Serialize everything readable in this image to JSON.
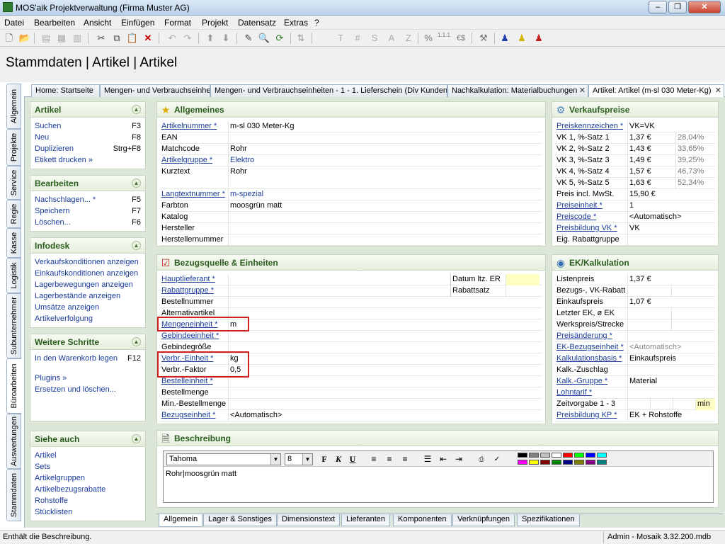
{
  "window": {
    "title": "MOS'aik Projektverwaltung (Firma Muster AG)",
    "min": "–",
    "max": "❐",
    "close": "✕"
  },
  "menu": [
    "Datei",
    "Bearbeiten",
    "Ansicht",
    "Einfügen",
    "Format",
    "Projekt",
    "Datensatz",
    "Extras",
    "?"
  ],
  "toolbar_icons": [
    "new-icon",
    "open-icon",
    "print-icon",
    "print-preview-icon",
    "print-setup-icon",
    "cut-icon",
    "copy-icon",
    "paste-icon",
    "delete-icon",
    "undo-icon",
    "redo-icon",
    "up-icon",
    "down-icon",
    "edit-icon",
    "search-icon",
    "refresh-icon",
    "sort-icon",
    "T",
    "#",
    "S",
    "A",
    "Z",
    "%",
    "1.1.1",
    "€$",
    "tools-icon",
    "user-blue-icon",
    "user-yellow-icon",
    "user-red-icon"
  ],
  "heading": "Stammdaten | Artikel | Artikel",
  "vtabs": [
    "Allgemein",
    "Projekte",
    "Service",
    "Regie",
    "Kasse",
    "Logistik",
    "Subunternehmer",
    "Büroarbeiten",
    "Auswertungen",
    "Stammdaten"
  ],
  "doctabs": [
    {
      "label": "Home: Startseite"
    },
    {
      "label": "Mengen- und Verbrauchseinhe"
    },
    {
      "label": "Mengen- und Verbrauchseinheiten - 1 - 1. Lieferschein (Div Kunden)"
    },
    {
      "label": "Nachkalkulation: Materialbuchungen"
    },
    {
      "label": "Artikel: Artikel (m-sl 030 Meter-Kg)"
    }
  ],
  "left_panels": {
    "artikel": {
      "title": "Artikel",
      "items": [
        {
          "label": "Suchen",
          "key": "F3"
        },
        {
          "label": "Neu",
          "key": "F8"
        },
        {
          "label": "Duplizieren",
          "key": "Strg+F8"
        },
        {
          "label": "Etikett drucken »",
          "key": ""
        }
      ]
    },
    "bearbeiten": {
      "title": "Bearbeiten",
      "items": [
        {
          "label": "Nachschlagen... *",
          "key": "F5"
        },
        {
          "label": "Speichern",
          "key": "F7"
        },
        {
          "label": "Löschen...",
          "key": "F6"
        }
      ]
    },
    "infodesk": {
      "title": "Infodesk",
      "items": [
        {
          "label": "Verkaufskonditionen anzeigen"
        },
        {
          "label": "Einkaufskonditionen anzeigen"
        },
        {
          "label": "Lagerbewegungen anzeigen"
        },
        {
          "label": "Lagerbestände anzeigen"
        },
        {
          "label": "Umsätze anzeigen"
        },
        {
          "label": "Artikelverfolgung"
        }
      ]
    },
    "weitere": {
      "title": "Weitere Schritte",
      "items": [
        {
          "label": "In den Warenkorb legen",
          "key": "F12"
        },
        {
          "label": "Plugins »",
          "key": ""
        },
        {
          "label": "Ersetzen und löschen...",
          "key": ""
        }
      ]
    },
    "siehe": {
      "title": "Siehe auch",
      "items": [
        {
          "label": "Artikel"
        },
        {
          "label": "Sets"
        },
        {
          "label": "Artikelgruppen"
        },
        {
          "label": "Artikelbezugsrabatte"
        },
        {
          "label": "Rohstoffe"
        },
        {
          "label": "Stücklisten"
        }
      ]
    }
  },
  "allgemeines": {
    "title": "Allgemeines",
    "rows": [
      {
        "label": "Artikelnummer *",
        "value": "m-sl 030 Meter-Kg",
        "link": true
      },
      {
        "label": "EAN",
        "value": "",
        "link": false
      },
      {
        "label": "Matchcode",
        "value": "Rohr",
        "link": false
      },
      {
        "label": "Artikelgruppe *",
        "value": "Elektro",
        "link": true,
        "blue": true
      },
      {
        "label": "Kurztext",
        "value": "Rohr",
        "link": false,
        "tall": true
      },
      {
        "label": "Langtextnummer *",
        "value": "m-spezial",
        "link": true,
        "blue": true
      },
      {
        "label": "Farbton",
        "value": "moosgrün matt",
        "link": false
      },
      {
        "label": "Katalog",
        "value": "",
        "link": false
      },
      {
        "label": "Hersteller",
        "value": "",
        "link": false
      },
      {
        "label": "Herstellernummer",
        "value": "",
        "link": false
      }
    ]
  },
  "verkaufspreise": {
    "title": "Verkaufspreise",
    "rows": [
      {
        "label": "Preiskennzeichen *",
        "value": "VK=VK",
        "pct": "",
        "link": true
      },
      {
        "label": "VK 1, %-Satz 1",
        "value": "1,37 €",
        "pct": "28,04%"
      },
      {
        "label": "VK 2, %-Satz 2",
        "value": "1,43 €",
        "pct": "33,65%"
      },
      {
        "label": "VK 3, %-Satz 3",
        "value": "1,49 €",
        "pct": "39,25%"
      },
      {
        "label": "VK 4, %-Satz 4",
        "value": "1,57 €",
        "pct": "46,73%"
      },
      {
        "label": "VK 5, %-Satz 5",
        "value": "1,63 €",
        "pct": "52,34%"
      },
      {
        "label": "Preis incl. MwSt.",
        "value": "15,90 €",
        "pct": ""
      },
      {
        "label": "Preiseinheit *",
        "value": "1",
        "pct": "",
        "link": true
      },
      {
        "label": "Preiscode *",
        "value": "<Automatisch>",
        "pct": "",
        "link": true
      },
      {
        "label": "Preisbildung VK *",
        "value": "VK",
        "pct": "",
        "link": true
      },
      {
        "label": "Eig. Rabattgruppe",
        "value": "",
        "pct": ""
      }
    ]
  },
  "bezugsquelle": {
    "title": "Bezugsquelle & Einheiten",
    "rows": [
      {
        "label": "Hauptlieferant *",
        "value": "",
        "link": true
      },
      {
        "label": "Rabattgruppe *",
        "value": "",
        "link": true
      },
      {
        "label": "Bestellnummer",
        "value": ""
      },
      {
        "label": "Alternativartikel",
        "value": ""
      },
      {
        "label": "Mengeneinheit *",
        "value": "m",
        "link": true
      },
      {
        "label": "Gebindeeinheit *",
        "value": "",
        "link": true
      },
      {
        "label": "Gebindegröße",
        "value": ""
      },
      {
        "label": "Verbr.-Einheit *",
        "value": "kg",
        "link": true
      },
      {
        "label": "Verbr.-Faktor",
        "value": "0,5"
      },
      {
        "label": "Bestelleinheit *",
        "value": "",
        "link": true
      },
      {
        "label": "Bestellmenge",
        "value": ""
      },
      {
        "label": "Min.-Bestellmenge",
        "value": ""
      },
      {
        "label": "Bezugseinheit *",
        "value": "<Automatisch>",
        "link": true
      }
    ],
    "side": [
      {
        "label": "Datum ltz. ER",
        "value": ""
      },
      {
        "label": "Rabattsatz",
        "value": ""
      }
    ]
  },
  "ek": {
    "title": "EK/Kalkulation",
    "rows": [
      {
        "label": "Listenpreis",
        "value": "1,37 €"
      },
      {
        "label": "Bezugs-, VK-Rabatt",
        "value": ""
      },
      {
        "label": "Einkaufspreis",
        "value": "1,07 €"
      },
      {
        "label": "Letzter EK, ø EK",
        "value": ""
      },
      {
        "label": "Werkspreis/Strecke",
        "value": ""
      },
      {
        "label": "Preisänderung *",
        "value": "",
        "link": true
      },
      {
        "label": "EK-Bezugseinheit *",
        "value": "<Automatisch>",
        "link": true,
        "grey": true
      },
      {
        "label": "Kalkulationsbasis *",
        "value": "Einkaufspreis",
        "link": true
      },
      {
        "label": "Kalk.-Zuschlag",
        "value": ""
      },
      {
        "label": "Kalk.-Gruppe *",
        "value": "Material",
        "link": true
      },
      {
        "label": "Lohntarif *",
        "value": "",
        "link": true
      },
      {
        "label": "Zeitvorgabe 1 - 3",
        "value": "",
        "unit": "min"
      },
      {
        "label": "Preisbildung KP *",
        "value": "EK + Rohstoffe",
        "link": true
      }
    ]
  },
  "beschreibung": {
    "title": "Beschreibung",
    "font": "Tahoma",
    "size": "8",
    "text": "Rohr|moosgrün matt"
  },
  "bottom_tabs": [
    "Allgemein",
    "Lager & Sonstiges",
    "Dimensionstext",
    "Lieferanten",
    "Komponenten",
    "Verknüpfungen",
    "Spezifikationen"
  ],
  "status": {
    "left": "Enthält die Beschreibung.",
    "right": "Admin - Mosaik 3.32.200.mdb"
  },
  "colors": {
    "panel_bg": "#dde7d9",
    "header_green": "#2a5d1c",
    "link_blue": "#1a3c9a",
    "highlight_red": "#d02020"
  }
}
